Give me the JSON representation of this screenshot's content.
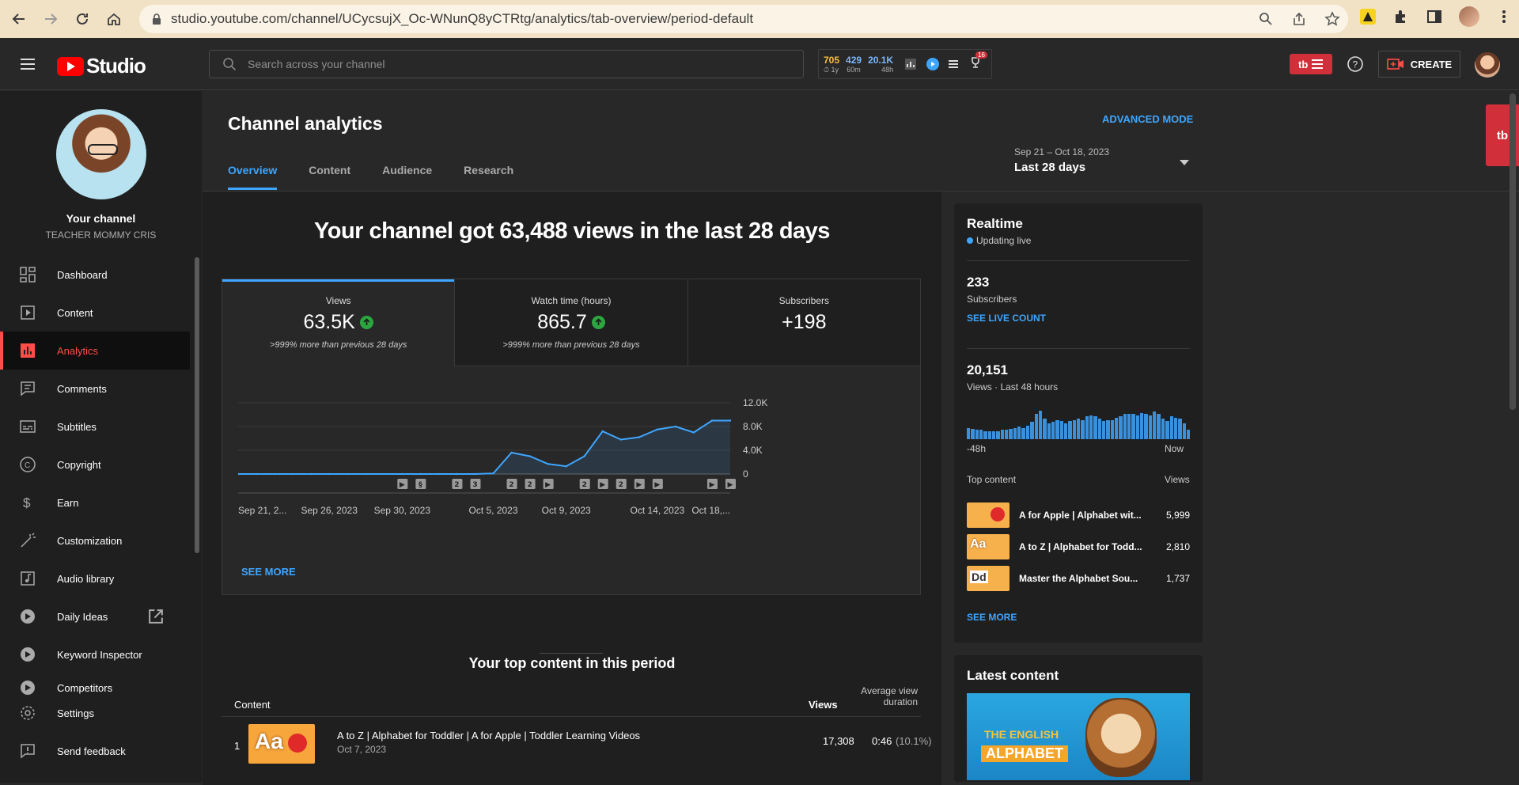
{
  "browser": {
    "url": "studio.youtube.com/channel/UCycsujX_Oc-WNunQ8yCTRtg/analytics/tab-overview/period-default"
  },
  "header": {
    "logo_text": "Studio",
    "search_placeholder": "Search across your channel",
    "stats": [
      {
        "value": "705",
        "sub": "1y",
        "color": "#f9c23c"
      },
      {
        "value": "429",
        "sub": "60m",
        "color": "#7ab8ff"
      },
      {
        "value": "20.1K",
        "sub": "48h",
        "color": "#7ab8ff"
      }
    ],
    "badge_count": "16",
    "create_label": "CREATE"
  },
  "sidebar": {
    "your_channel": "Your channel",
    "channel_name": "TEACHER MOMMY CRIS",
    "items": [
      {
        "label": "Dashboard",
        "icon": "dashboard-icon"
      },
      {
        "label": "Content",
        "icon": "content-icon"
      },
      {
        "label": "Analytics",
        "icon": "analytics-icon",
        "active": true
      },
      {
        "label": "Comments",
        "icon": "comments-icon"
      },
      {
        "label": "Subtitles",
        "icon": "subtitles-icon"
      },
      {
        "label": "Copyright",
        "icon": "copyright-icon"
      },
      {
        "label": "Earn",
        "icon": "earn-icon"
      },
      {
        "label": "Customization",
        "icon": "customization-icon"
      },
      {
        "label": "Audio library",
        "icon": "audio-library-icon"
      },
      {
        "label": "Daily Ideas",
        "icon": "daily-ideas-icon"
      },
      {
        "label": "Keyword Inspector",
        "icon": "keyword-inspector-icon"
      },
      {
        "label": "Competitors",
        "icon": "competitors-icon"
      }
    ],
    "bottom": [
      {
        "label": "Settings",
        "icon": "settings-icon"
      },
      {
        "label": "Send feedback",
        "icon": "feedback-icon"
      }
    ]
  },
  "main": {
    "title": "Channel analytics",
    "advanced_mode": "ADVANCED MODE",
    "tabs": [
      "Overview",
      "Content",
      "Audience",
      "Research"
    ],
    "date_range": "Sep 21 – Oct 18, 2023",
    "date_label": "Last 28 days",
    "headline": "Your channel got 63,488 views in the last 28 days",
    "metrics": [
      {
        "label": "Views",
        "value": "63.5K",
        "note": ">999% more than previous 28 days",
        "up": true
      },
      {
        "label": "Watch time (hours)",
        "value": "865.7",
        "note": ">999% more than previous 28 days",
        "up": true
      },
      {
        "label": "Subscribers",
        "value": "+198",
        "note": "",
        "up": false
      }
    ],
    "see_more": "SEE MORE",
    "top_content_title": "Your top content in this period",
    "table_headers": {
      "content": "Content",
      "views": "Views",
      "avd_line1": "Average view",
      "avd_line2": "duration"
    },
    "rows": [
      {
        "rank": "1",
        "title": "A to Z | Alphabet for Toddler | A for Apple | Toddler Learning Videos",
        "date": "Oct 7, 2023",
        "views": "17,308",
        "avd": "0:46",
        "avd_pct": "(10.1%)"
      }
    ]
  },
  "chart_data": {
    "type": "area",
    "x": [
      "Sep 21",
      "Sep 22",
      "Sep 23",
      "Sep 24",
      "Sep 25",
      "Sep 26",
      "Sep 27",
      "Sep 28",
      "Sep 29",
      "Sep 30",
      "Oct 1",
      "Oct 2",
      "Oct 3",
      "Oct 4",
      "Oct 5",
      "Oct 6",
      "Oct 7",
      "Oct 8",
      "Oct 9",
      "Oct 10",
      "Oct 11",
      "Oct 12",
      "Oct 13",
      "Oct 14",
      "Oct 15",
      "Oct 16",
      "Oct 17",
      "Oct 18"
    ],
    "values": [
      0,
      0,
      0,
      0,
      0,
      0,
      0,
      0,
      0,
      0,
      0,
      0,
      0,
      0,
      100,
      3600,
      3000,
      1700,
      1300,
      3000,
      7200,
      5800,
      6200,
      7500,
      8000,
      7000,
      9000,
      9000
    ],
    "x_ticks": [
      "Sep 21, 2...",
      "Sep 26, 2023",
      "Sep 30, 2023",
      "Oct 5, 2023",
      "Oct 9, 2023",
      "Oct 14, 2023",
      "Oct 18,..."
    ],
    "y_ticks": [
      "12.0K",
      "8.0K",
      "4.0K",
      "0"
    ],
    "ylim": [
      0,
      12000
    ],
    "markers": [
      {
        "x": "Sep 30",
        "label": "▶"
      },
      {
        "x": "Oct 1",
        "label": "§"
      },
      {
        "x": "Oct 3",
        "label": "2"
      },
      {
        "x": "Oct 4",
        "label": "3"
      },
      {
        "x": "Oct 6",
        "label": "2"
      },
      {
        "x": "Oct 7",
        "label": "2"
      },
      {
        "x": "Oct 8",
        "label": "▶"
      },
      {
        "x": "Oct 10",
        "label": "2"
      },
      {
        "x": "Oct 11",
        "label": "▶"
      },
      {
        "x": "Oct 12",
        "label": "2"
      },
      {
        "x": "Oct 13",
        "label": "▶"
      },
      {
        "x": "Oct 14",
        "label": "▶"
      },
      {
        "x": "Oct 17",
        "label": "▶"
      },
      {
        "x": "Oct 18",
        "label": "▶"
      }
    ],
    "color": "#3ea6ff"
  },
  "realtime": {
    "title": "Realtime",
    "status": "Updating live",
    "subs_value": "233",
    "subs_label": "Subscribers",
    "see_live_count": "SEE LIVE COUNT",
    "views_value": "20,151",
    "views_label": "Views · Last 48 hours",
    "x_start": "-48h",
    "x_end": "Now",
    "bars": [
      10,
      9,
      8,
      8,
      7,
      7,
      7,
      7,
      8,
      8,
      9,
      10,
      11,
      10,
      12,
      15,
      22,
      25,
      18,
      14,
      15,
      17,
      16,
      14,
      16,
      17,
      18,
      17,
      20,
      21,
      20,
      18,
      16,
      17,
      17,
      19,
      20,
      22,
      22,
      22,
      21,
      23,
      22,
      21,
      24,
      22,
      18,
      16,
      20,
      19,
      18,
      14,
      8
    ],
    "top_content_label": "Top content",
    "views_col": "Views",
    "top_content": [
      {
        "title": "A for Apple | Alphabet wit...",
        "views": "5,999"
      },
      {
        "title": "A to Z | Alphabet for Todd...",
        "views": "2,810"
      },
      {
        "title": "Master the Alphabet Sou...",
        "views": "1,737"
      }
    ],
    "see_more": "SEE MORE"
  },
  "latest": {
    "title": "Latest content",
    "thumb_line1": "THE ENGLISH",
    "thumb_line2": "ALPHABET"
  }
}
